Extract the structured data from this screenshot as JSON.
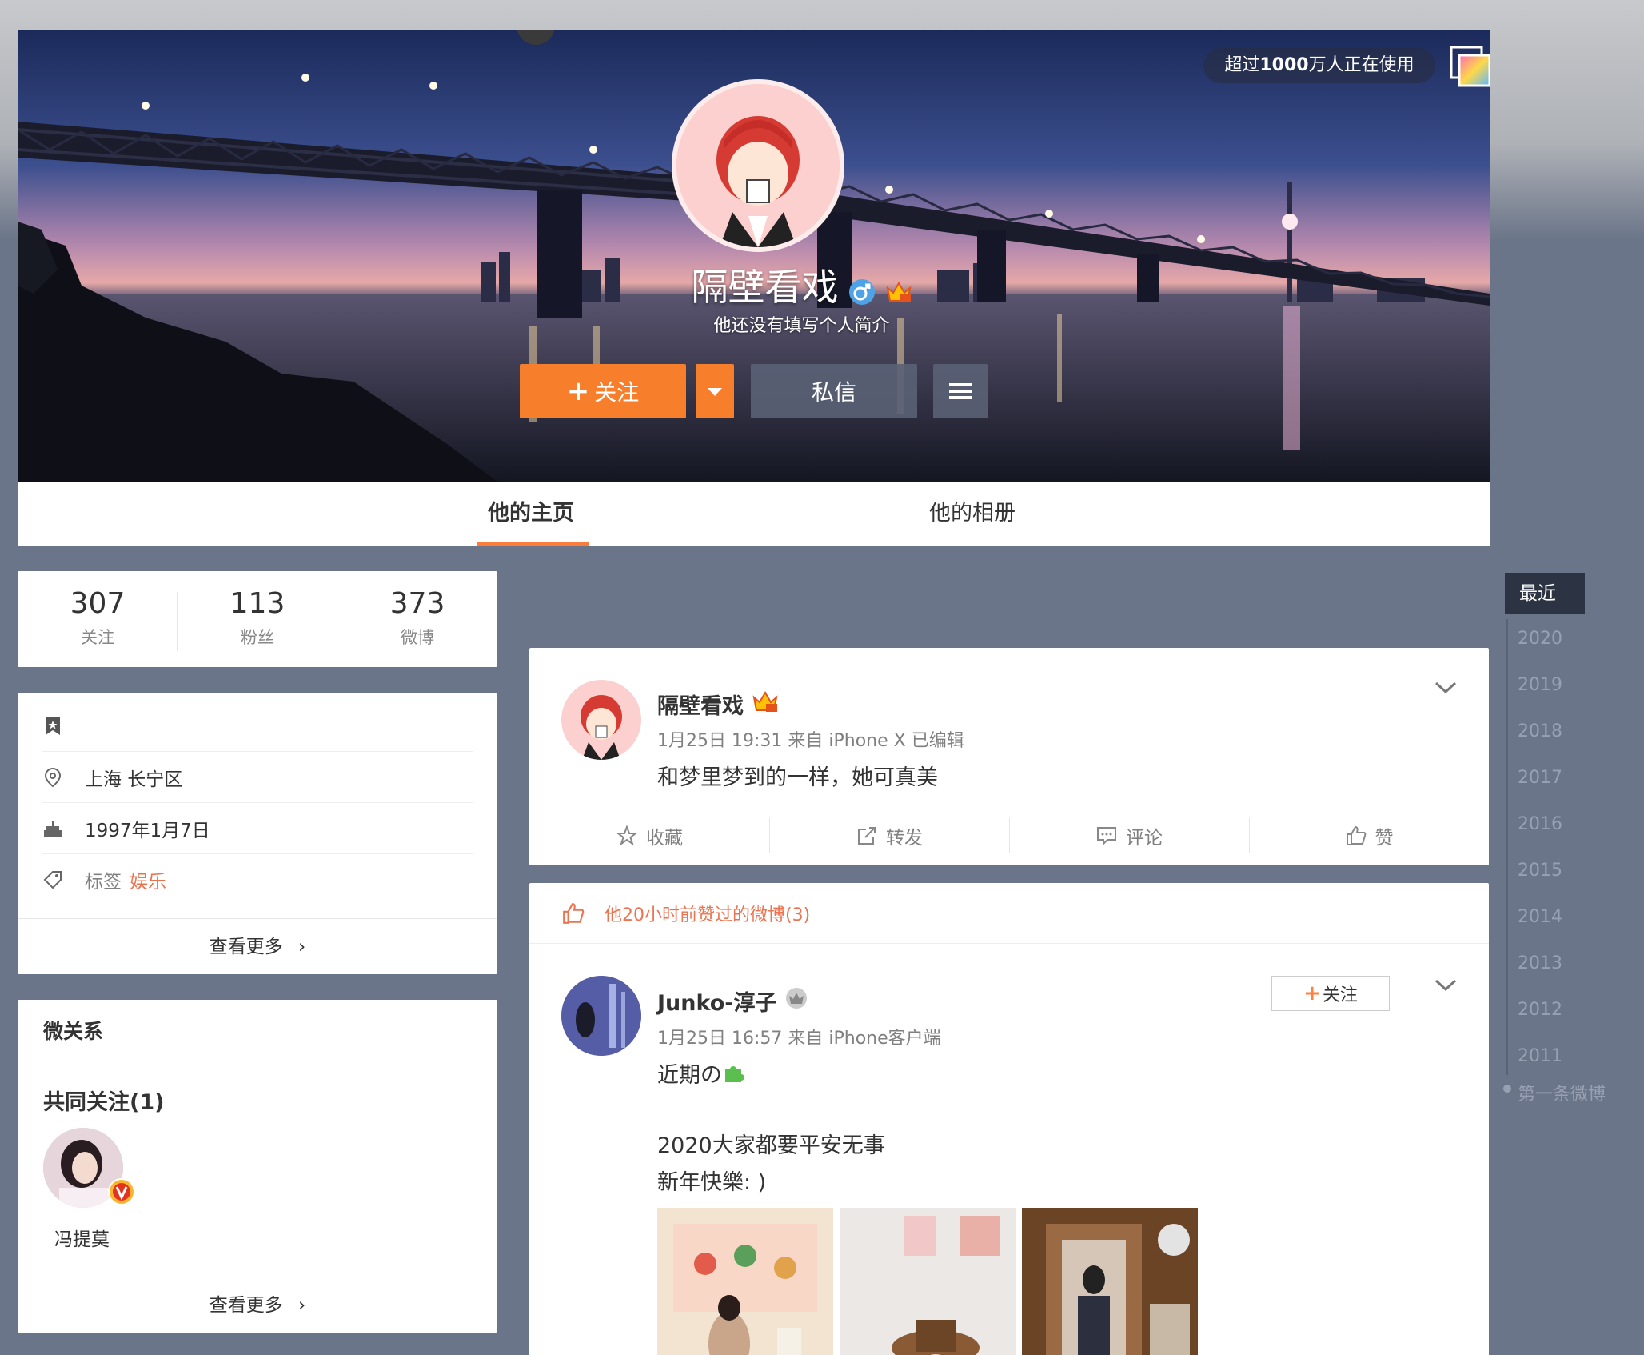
{
  "cover": {
    "user_count_prefix": "超过",
    "user_count_number": "1000",
    "user_count_suffix": "万人正在使用",
    "skin_icon": "skin-change-icon"
  },
  "profile": {
    "name": "隔壁看戏",
    "bio": "他还没有填写个人简介",
    "follow_label": "关注",
    "message_label": "私信"
  },
  "tabs": [
    {
      "label": "他的主页",
      "active": true
    },
    {
      "label": "他的相册",
      "active": false
    }
  ],
  "stats": [
    {
      "value": "307",
      "label": "关注"
    },
    {
      "value": "113",
      "label": "粉丝"
    },
    {
      "value": "373",
      "label": "微博"
    }
  ],
  "info": {
    "location": "上海 长宁区",
    "birthday": "1997年1月7日",
    "tag_label": "标签",
    "tag_value": "娱乐",
    "see_more": "查看更多"
  },
  "relation": {
    "title": "微关系",
    "mutual_title": "共同关注(1)",
    "mutual_name": "冯提莫",
    "see_more": "查看更多"
  },
  "post1": {
    "author": "隔壁看戏",
    "meta": "1月25日 19:31 来自 iPhone X   已编辑",
    "text": "和梦里梦到的一样，她可真美",
    "actions": [
      "收藏",
      "转发",
      "评论",
      "赞"
    ]
  },
  "post2": {
    "liked_notice": "他20小时前赞过的微博(3)",
    "author": "Junko-淳子",
    "follow_label": "关注",
    "meta": "1月25日 16:57 来自 iPhone客户端",
    "line1": "近期の",
    "line2": "2020大家都要平安无事",
    "line3": "新年快樂: )"
  },
  "timeline": {
    "active": "最近",
    "years": [
      "2020",
      "2019",
      "2018",
      "2017",
      "2016",
      "2015",
      "2014",
      "2013",
      "2012",
      "2011"
    ],
    "first": "第一条微博"
  },
  "colors": {
    "accent": "#f77e2b",
    "link": "#eb7350",
    "page_bg": "#6b7589"
  }
}
